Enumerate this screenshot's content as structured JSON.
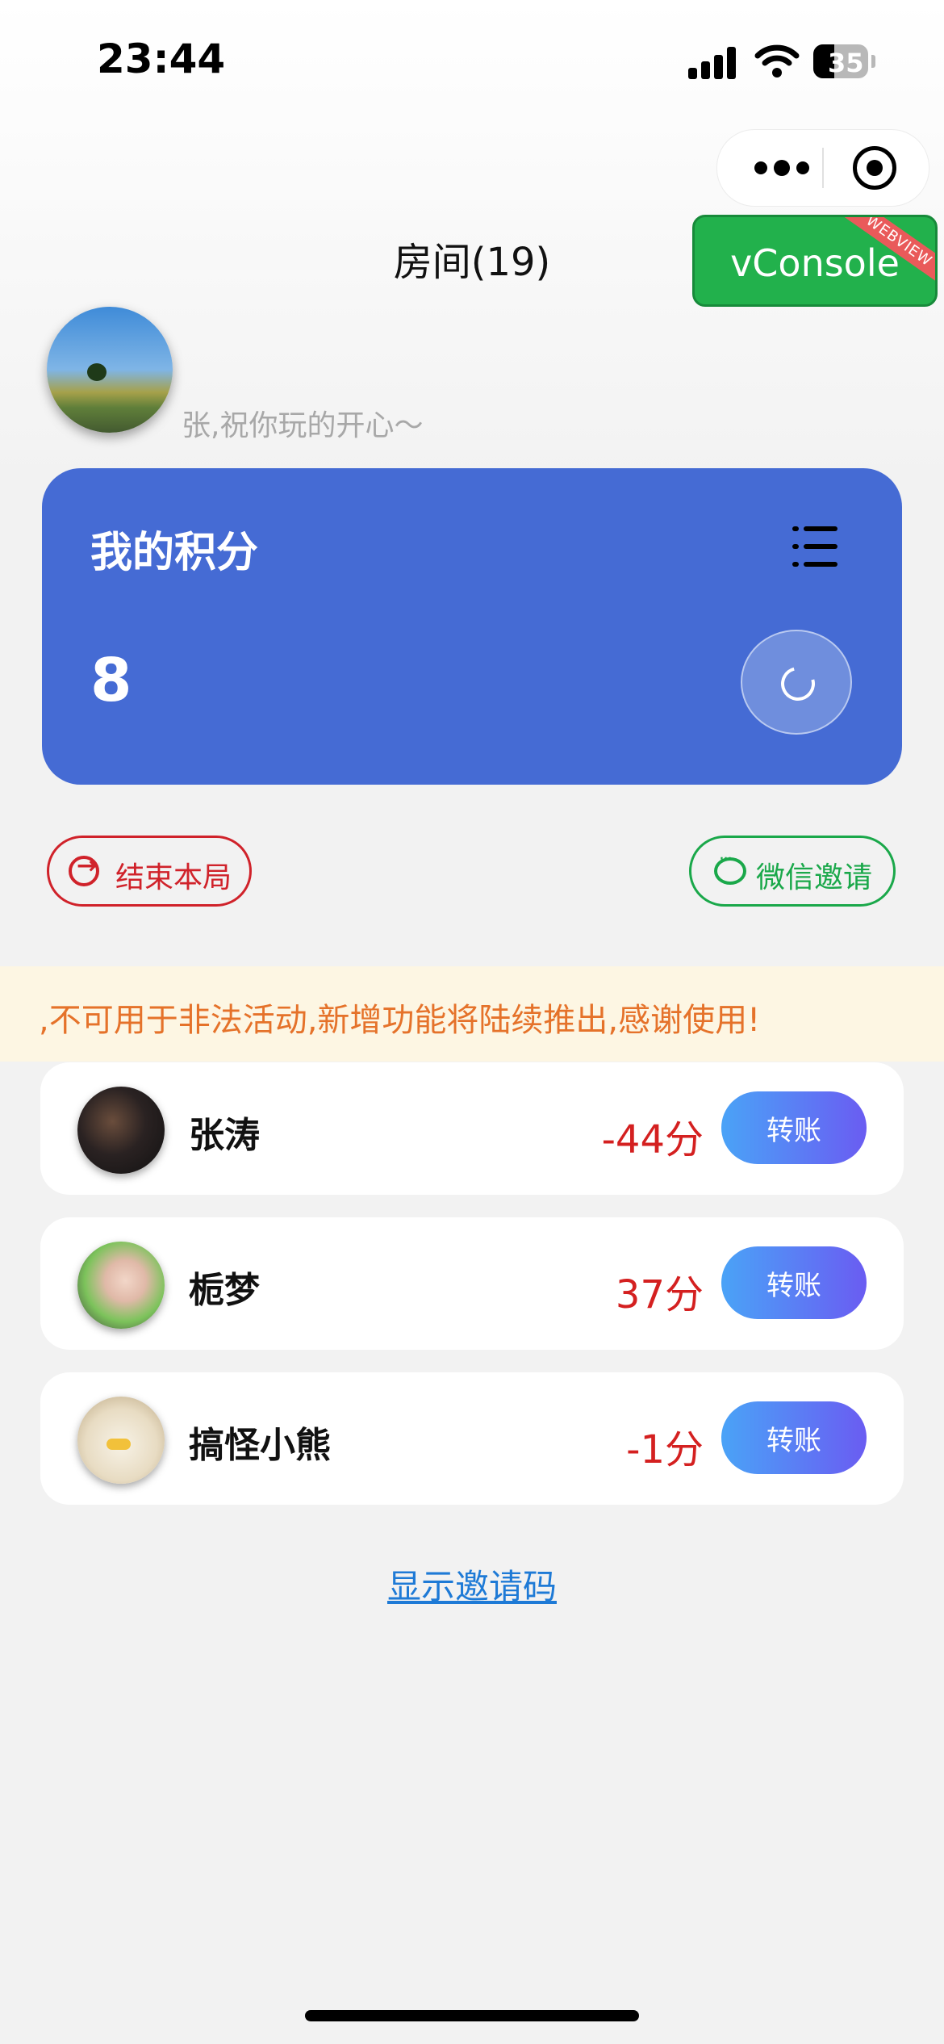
{
  "status_bar": {
    "time": "23:44",
    "battery": "35"
  },
  "nav": {
    "title": "房间(19)"
  },
  "vconsole": {
    "label": "vConsole",
    "ribbon": "WEBVIEW"
  },
  "user": {
    "greeting": "张,祝你玩的开心～"
  },
  "score_card": {
    "title": "我的积分",
    "value": "8"
  },
  "actions": {
    "end_label": "结束本局",
    "invite_label": "微信邀请"
  },
  "notice": {
    "text": ",不可用于非法活动,新增功能将陆续推出,感谢使用!"
  },
  "players": [
    {
      "name": "张涛",
      "score": "-44分",
      "button": "转账"
    },
    {
      "name": "栀梦",
      "score": "37分",
      "button": "转账"
    },
    {
      "name": "搞怪小熊",
      "score": "-1分",
      "button": "转账"
    }
  ],
  "show_code": "显示邀请码",
  "colors": {
    "card_blue": "#456bd4",
    "end_red": "#d0222a",
    "invite_green": "#1aa84a",
    "score_red": "#d42020",
    "notice_orange": "#e5722a",
    "link_blue": "#1e7ad6"
  }
}
